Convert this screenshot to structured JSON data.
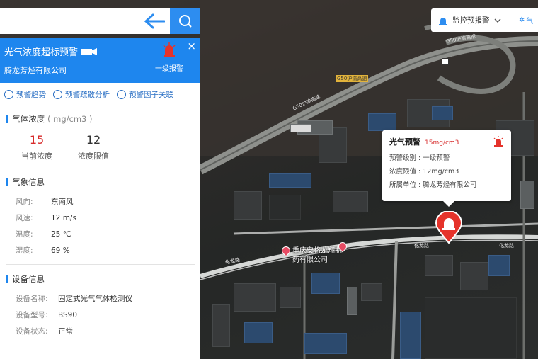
{
  "search": {
    "value": "",
    "placeholder": ""
  },
  "panel": {
    "title": "光气浓度超标预警",
    "company": "腾龙芳烃有限公司",
    "alarm_level": "一级报警",
    "close": "×",
    "actions": [
      {
        "label": "预警趋势"
      },
      {
        "label": "预警疏散分析"
      },
      {
        "label": "预警因子关联"
      }
    ],
    "concentration": {
      "title": "气体浓度",
      "unit": "( mg/cm3 )",
      "current_value": "15",
      "current_label": "当前浓度",
      "limit_value": "12",
      "limit_label": "浓度限值"
    },
    "weather": {
      "title": "气象信息",
      "rows": [
        {
          "key": "风向:",
          "value": "东南风"
        },
        {
          "key": "风速:",
          "value": "12 m/s"
        },
        {
          "key": "温度:",
          "value": "25 ℃"
        },
        {
          "key": "湿度:",
          "value": "69 %"
        }
      ]
    },
    "device": {
      "title": "设备信息",
      "rows": [
        {
          "key": "设备名称:",
          "value": "固定式光气气体检测仪"
        },
        {
          "key": "设备型号:",
          "value": "BS90"
        },
        {
          "key": "设备状态:",
          "value": "正常"
        }
      ]
    }
  },
  "top_right": {
    "monitor_label": "监控预报警",
    "second_label": "气"
  },
  "popup": {
    "title": "光气预警",
    "value": "15mg/cm3",
    "rows": [
      {
        "text": "预警级别 : 一级预警"
      },
      {
        "text": "浓度限值 : 12mg/cm3"
      },
      {
        "text": "所属单位 : 腾龙芳烃有限公司"
      }
    ]
  },
  "map": {
    "road_labels": [
      "G50沪渝高速",
      "G50沪渝高速",
      "G50沪渝高速",
      "化龙路",
      "化龙路",
      "化龙路"
    ],
    "poi": "重庆安格龙翔制药有限公司"
  },
  "colors": {
    "brand": "#1e86ee",
    "alert": "#d72b2b"
  }
}
